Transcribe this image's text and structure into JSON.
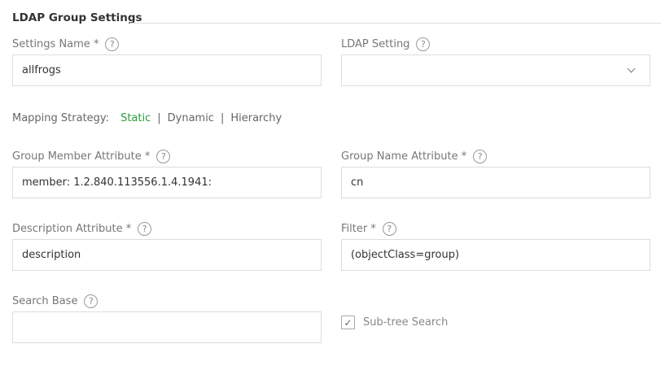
{
  "section_title": "LDAP Group Settings",
  "fields": {
    "settings_name": {
      "label": "Settings Name *",
      "value": "allfrogs"
    },
    "ldap_setting": {
      "label": "LDAP Setting",
      "value": ""
    },
    "group_member_attribute": {
      "label": "Group Member Attribute *",
      "value": "member: 1.2.840.113556.1.4.1941:"
    },
    "group_name_attribute": {
      "label": "Group Name Attribute *",
      "value": "cn"
    },
    "description_attribute": {
      "label": "Description Attribute *",
      "value": "description"
    },
    "filter": {
      "label": "Filter *",
      "value": "(objectClass=group)"
    },
    "search_base": {
      "label": "Search Base",
      "value": ""
    }
  },
  "mapping": {
    "label": "Mapping Strategy:",
    "options": [
      "Static",
      "Dynamic",
      "Hierarchy"
    ],
    "separator": "|",
    "selected": "Static",
    "accent": "#2a9a3a"
  },
  "subtree": {
    "label": "Sub-tree Search",
    "checked": true,
    "check_glyph": "✓"
  },
  "help_glyph": "?"
}
